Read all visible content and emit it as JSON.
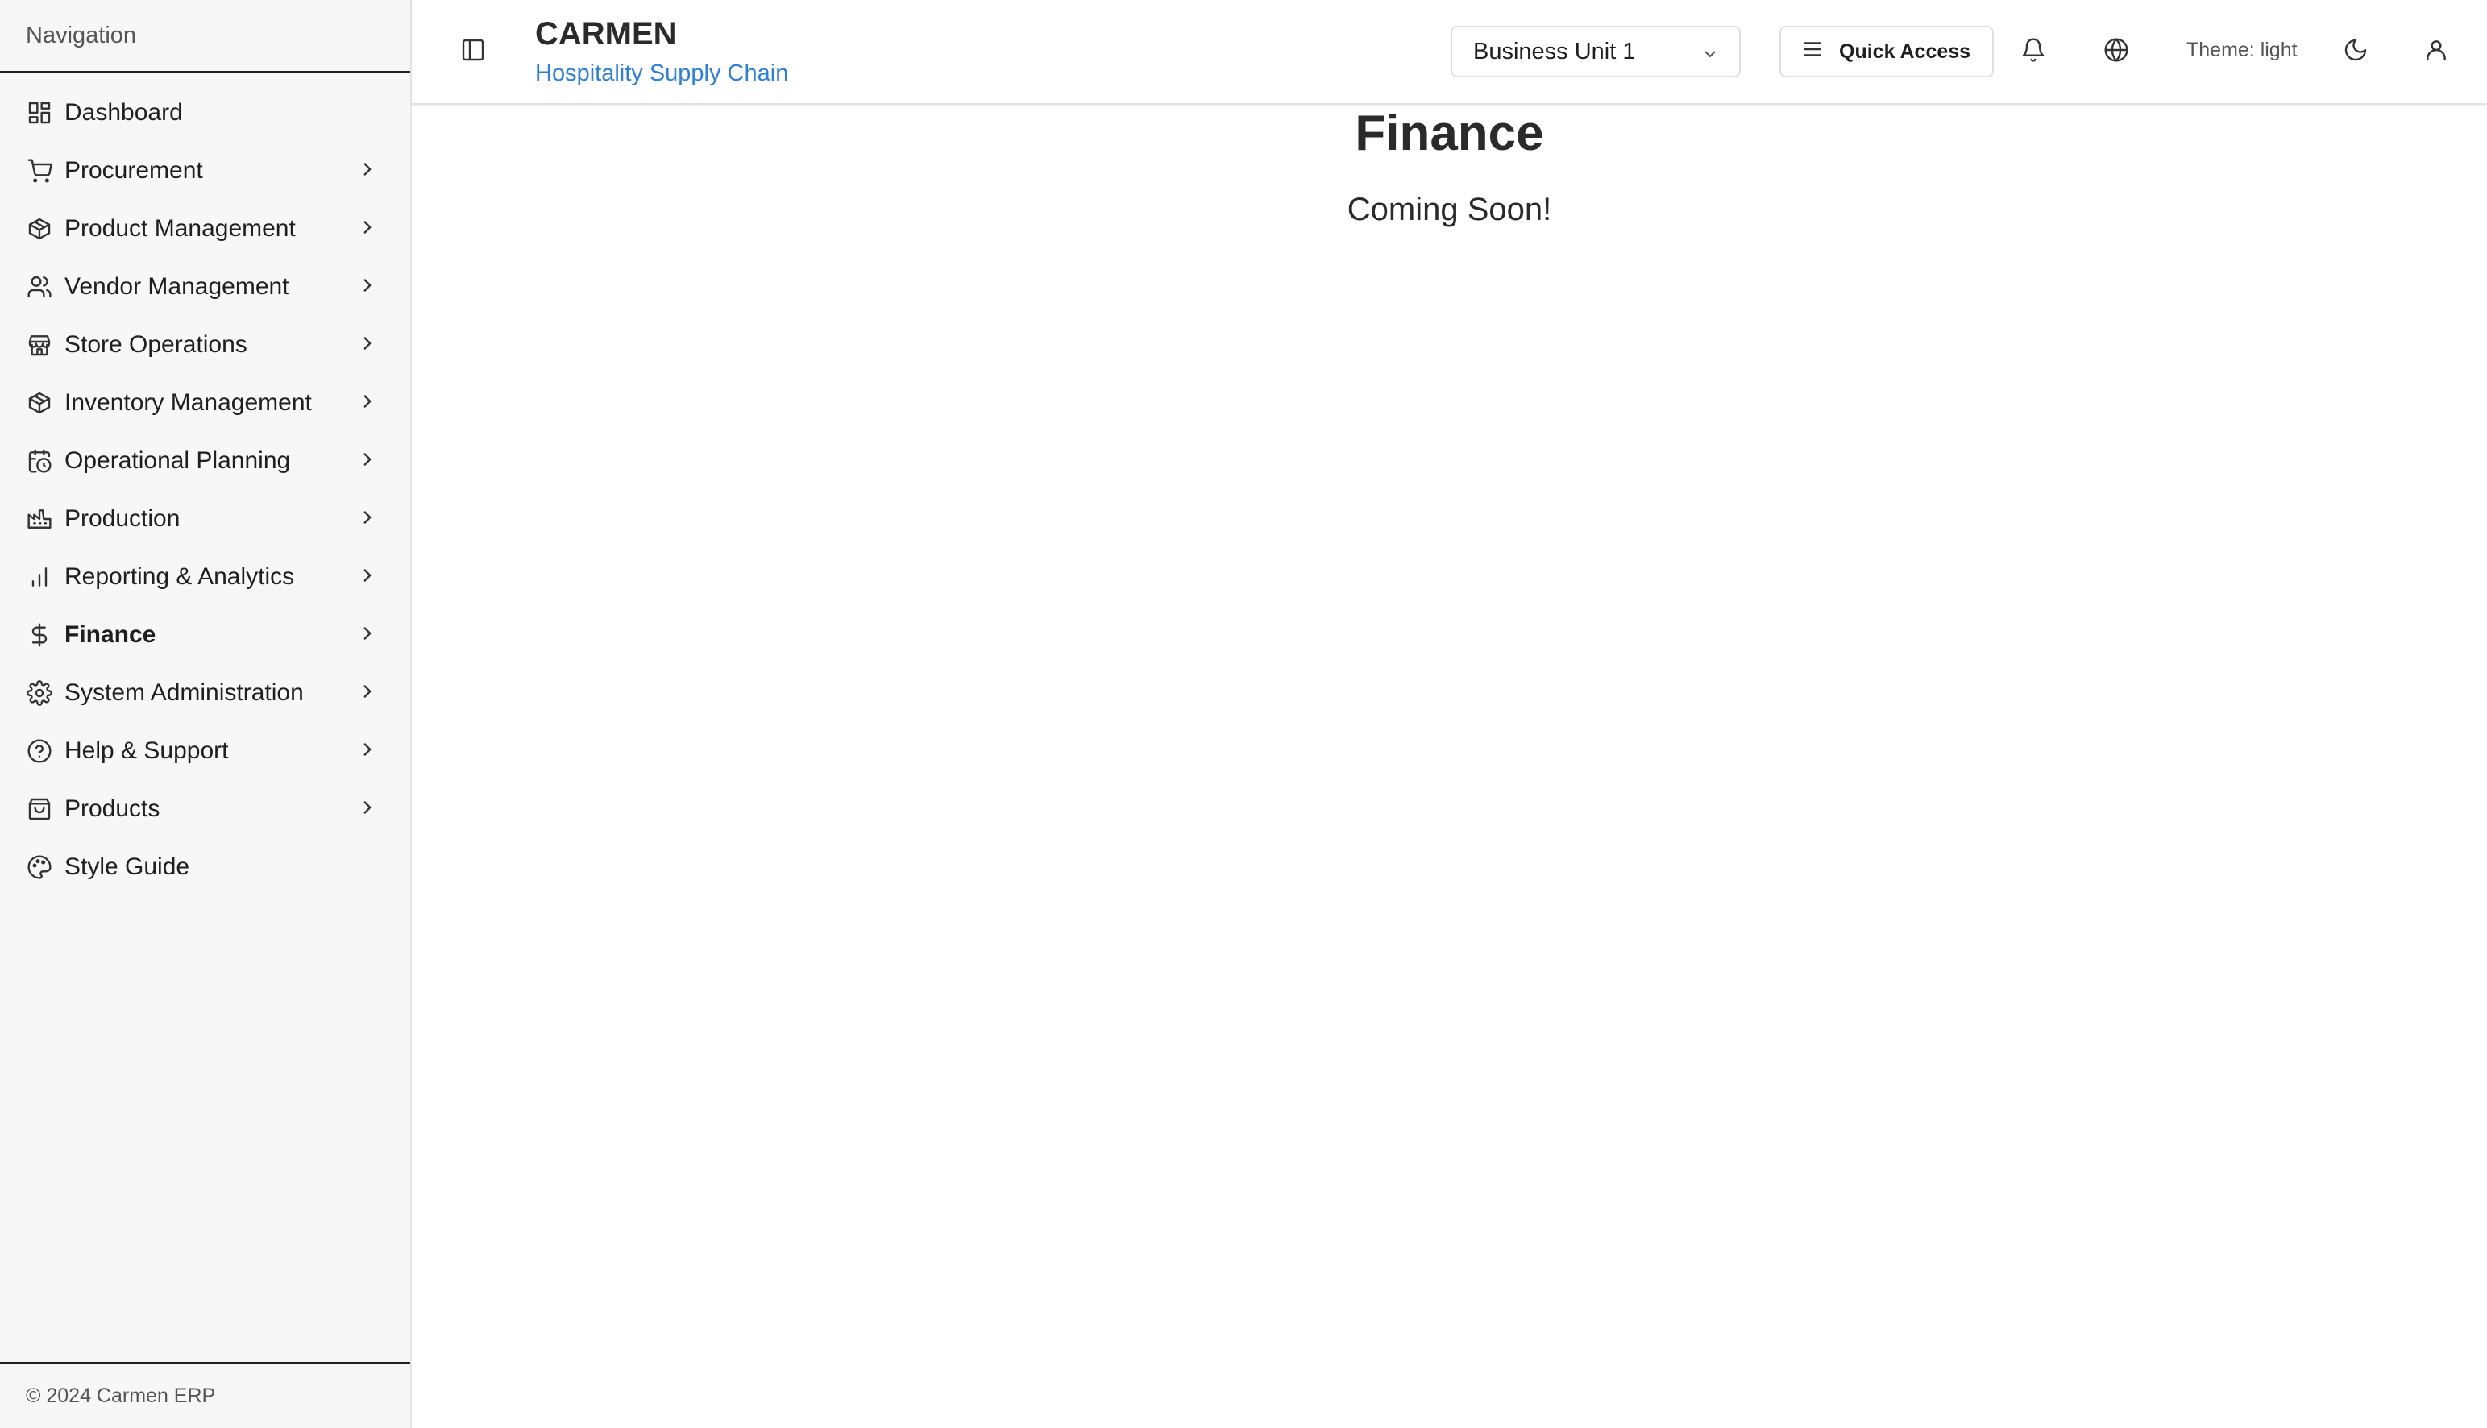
{
  "sidebar": {
    "heading": "Navigation",
    "items": [
      {
        "label": "Dashboard",
        "icon": "dashboard-icon"
      },
      {
        "label": "Procurement",
        "icon": "shopping-cart-icon"
      },
      {
        "label": "Product Management",
        "icon": "package-icon"
      },
      {
        "label": "Vendor Management",
        "icon": "users-icon"
      },
      {
        "label": "Store Operations",
        "icon": "store-icon"
      },
      {
        "label": "Inventory Management",
        "icon": "package-icon"
      },
      {
        "label": "Operational Planning",
        "icon": "calendar-clock-icon"
      },
      {
        "label": "Production",
        "icon": "factory-icon"
      },
      {
        "label": "Reporting & Analytics",
        "icon": "bar-chart-icon"
      },
      {
        "label": "Finance",
        "icon": "dollar-sign-icon"
      },
      {
        "label": "System Administration",
        "icon": "settings-icon"
      },
      {
        "label": "Help & Support",
        "icon": "help-circle-icon"
      },
      {
        "label": "Products",
        "icon": "shopping-bag-icon"
      },
      {
        "label": "Style Guide",
        "icon": "palette-icon"
      }
    ],
    "footer": "© 2024 Carmen ERP"
  },
  "header": {
    "title": "CARMEN",
    "subtitle": "Hospitality Supply Chain",
    "business_unit": "Business Unit 1",
    "quick_access_label": "Quick Access",
    "theme_label": "Theme: light"
  },
  "main": {
    "title": "Finance",
    "subtitle": "Coming Soon!"
  },
  "colors": {
    "accent": "#2f7fd6",
    "sidebar_bg": "#f7f7f7"
  }
}
